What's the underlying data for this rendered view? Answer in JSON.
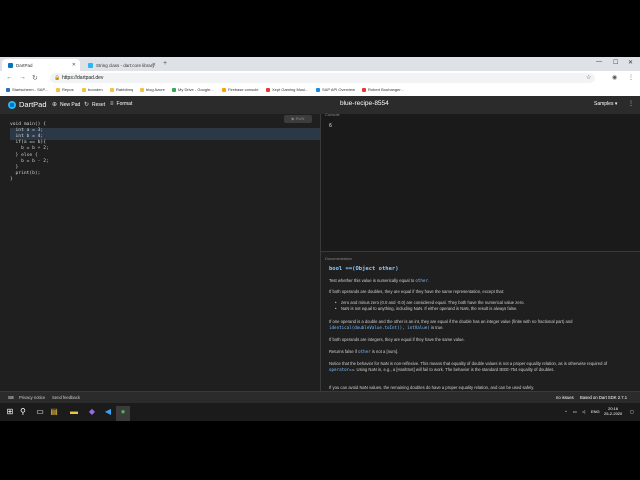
{
  "browser": {
    "tabs": [
      {
        "title": "DartPad",
        "active": true
      },
      {
        "title": "String class - dart:core library - Dart API",
        "active": false
      }
    ],
    "new_tab": "+",
    "url": "https://dartpad.dev",
    "bookmarks": [
      "Startscherm - SAP...",
      "Repos",
      "boorden",
      "Rabbitmq",
      "blog Azure",
      "My Drive - Google...",
      "Firebase console",
      "Xept Gaming Musi...",
      "SAP API Overview",
      "Robert Bouhanger..."
    ]
  },
  "dartpad": {
    "brand": "DartPad",
    "new_pad": "New Pad",
    "reset": "Reset",
    "format": "Format",
    "pad_name": "blue-recipe-8554",
    "samples": "Samples",
    "run": "RUN",
    "code_lines": [
      "void main() {",
      "  int a = 3;",
      "  int b = 4;",
      "  if(a == b){",
      "    b = b + 2;",
      "  } else {",
      "    b = b - 2;",
      "  }",
      "  print(b);",
      "}"
    ],
    "console": {
      "label": "Console",
      "output": "6"
    },
    "docs": {
      "label": "Documentation",
      "title": "bool ==(Object other)",
      "p1_pre": "Test whether this value is numerically equal to ",
      "p1_code": "other",
      "p1_post": ".",
      "p2": "If both operands are doubles, they are equal if they have the same representation, except that:",
      "li1": "zero and minus zero (0.0 and -0.0) are considered equal. They both have the numerical value zero.",
      "li2": "NaN is not equal to anything, including NaN. If either operand is NaN, the result is always false.",
      "p3_pre": "If one operand is a double and the other is an int, they are equal if the double has an integer value (finite with no fractional part) and ",
      "p3_code": "identical(doubleValue.toInt(), intValue)",
      "p3_post": " is true.",
      "p4": "If both operands are integers, they are equal if they have the same value.",
      "p5_pre": "Returns false if ",
      "p5_code": "other",
      "p5_post": " is not a [num].",
      "p6_pre": "Notice that the behavior for NaN is non-reflexive. This means that equality of double values is not a proper equality relation, as is otherwise required of ",
      "p6_code": "operator==",
      "p6_post": ". Using NaN in, e.g., a [HashSet] will fail to work. The behavior is the standard IEEE-754 equality of doubles.",
      "p7": "If you can avoid NaN values, the remaining doubles do have a proper equality relation, and can be used safely."
    },
    "footer": {
      "privacy": "Privacy notice",
      "feedback": "Send feedback",
      "issues": "no issues",
      "sdk": "Based on Dart SDK 2.7.1"
    }
  },
  "taskbar": {
    "lang": "ENG",
    "time": "20:16",
    "date": "25-2-2020"
  },
  "colors": {
    "accent": "#0175c2",
    "doc_title": "#8ecbff",
    "code_link": "#7fbfff"
  }
}
